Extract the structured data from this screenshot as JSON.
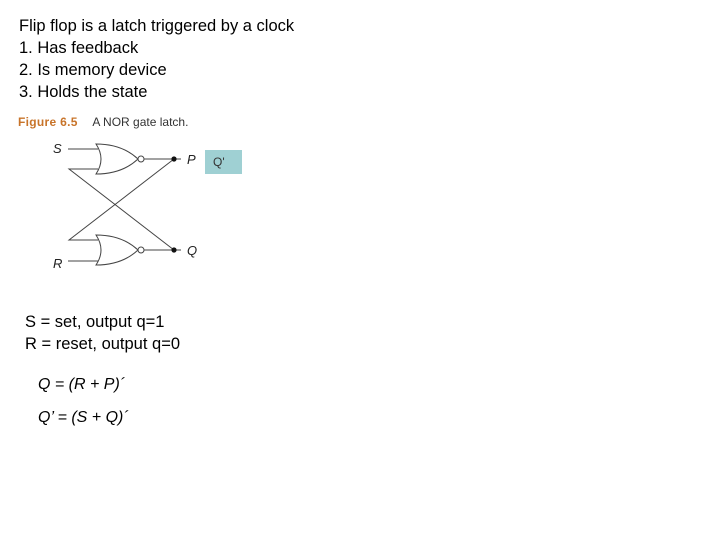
{
  "intro": {
    "lines": [
      "Flip flop is a latch triggered by a clock",
      "1. Has feedback",
      "2. Is memory device",
      "3. Holds the state"
    ]
  },
  "figure": {
    "number": "Figure 6.5",
    "caption": "A NOR gate latch.",
    "labels": {
      "s": "S",
      "r": "R",
      "p": "P",
      "q": "Q"
    },
    "annotation": "Q'",
    "annotation_color": "#9fd0d3",
    "number_color": "#c8742a"
  },
  "definitions": [
    "S = set, output  q=1",
    "R = reset, output q=0"
  ],
  "equations": [
    "Q = (R + P)´",
    "Q’ = (S + Q)´"
  ]
}
